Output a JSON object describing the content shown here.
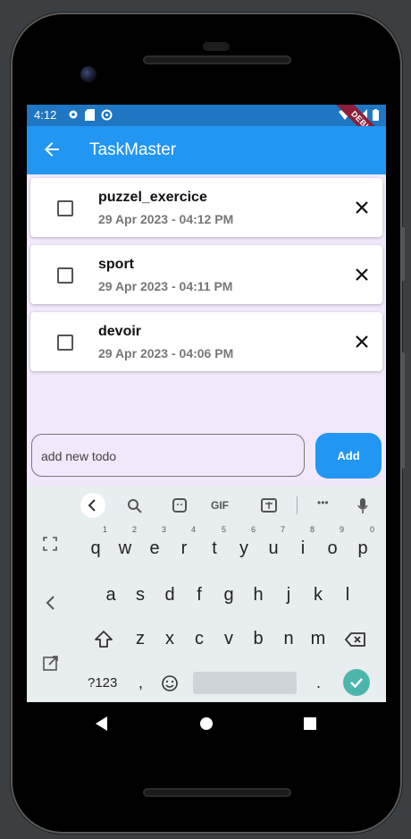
{
  "status_bar": {
    "time": "4:12",
    "debug_banner": "DEBUG"
  },
  "app_bar": {
    "title": "TaskMaster"
  },
  "todos": [
    {
      "name": "puzzel_exercice",
      "date": "29 Apr 2023 - 04:12 PM"
    },
    {
      "name": "sport",
      "date": "29 Apr 2023 - 04:11 PM"
    },
    {
      "name": "devoir",
      "date": "29 Apr 2023 - 04:06 PM"
    }
  ],
  "input": {
    "placeholder": "add new todo"
  },
  "add_button": {
    "label": "Add"
  },
  "keyboard": {
    "toolbar": {
      "gif": "GIF",
      "more": "•••"
    },
    "row1": [
      "q",
      "w",
      "e",
      "r",
      "t",
      "y",
      "u",
      "i",
      "o",
      "p"
    ],
    "row1_hints": [
      "1",
      "2",
      "3",
      "4",
      "5",
      "6",
      "7",
      "8",
      "9",
      "0"
    ],
    "row2": [
      "a",
      "s",
      "d",
      "f",
      "g",
      "h",
      "j",
      "k",
      "l"
    ],
    "row3": [
      "z",
      "x",
      "c",
      "v",
      "b",
      "n",
      "m"
    ],
    "symbols_key": "?123",
    "comma": ",",
    "period": "."
  },
  "colors": {
    "app_bar": "#2196f3",
    "status_bar": "#1f76c2",
    "background": "#f2e8fb",
    "enter_key": "#4db6ac"
  }
}
